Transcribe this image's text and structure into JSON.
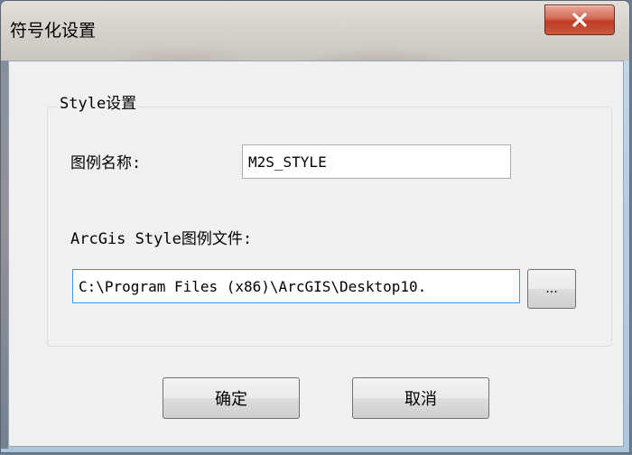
{
  "window": {
    "title": "符号化设置",
    "close_icon": "close-icon"
  },
  "group": {
    "label": "Style设置"
  },
  "legend_name": {
    "label": "图例名称:",
    "value": "M2S_STYLE"
  },
  "style_file": {
    "label": "ArcGis Style图例文件:",
    "value": "C:\\Program Files (x86)\\ArcGIS\\Desktop10.",
    "browse_label": "..."
  },
  "buttons": {
    "ok_label": "确定",
    "cancel_label": "取消"
  },
  "colors": {
    "close_button": "#c8503a",
    "client_bg": "#f0f0f0"
  }
}
